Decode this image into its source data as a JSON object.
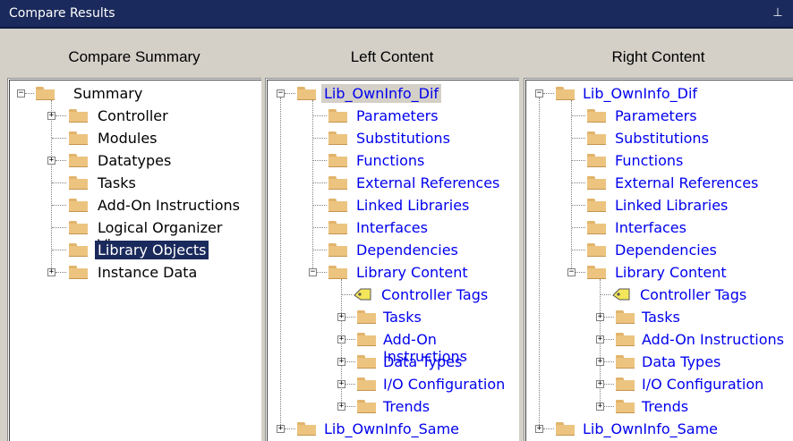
{
  "window": {
    "title": "Compare Results",
    "pin_glyph": "p"
  },
  "columns": {
    "summary_header": "Compare Summary",
    "left_header": "Left Content",
    "right_header": "Right Content"
  },
  "summary_tree": {
    "root": "Summary",
    "items": [
      {
        "label": "Controller",
        "expandable": true
      },
      {
        "label": "Modules",
        "expandable": false
      },
      {
        "label": "Datatypes",
        "expandable": true
      },
      {
        "label": "Tasks",
        "expandable": false
      },
      {
        "label": "Add-On Instructions",
        "expandable": false
      },
      {
        "label": "Logical Organizer View",
        "expandable": false
      },
      {
        "label": "Library Objects",
        "expandable": false,
        "selected": true
      },
      {
        "label": "Instance Data",
        "expandable": true
      }
    ]
  },
  "left_tree": {
    "root": "Lib_OwnInfo_Dif",
    "items": [
      "Parameters",
      "Substitutions",
      "Functions",
      "External References",
      "Linked Libraries",
      "Interfaces",
      "Dependencies"
    ],
    "library_content": "Library Content",
    "controller_tags": "Controller Tags",
    "sub_items": [
      "Tasks",
      "Add-On Instructions",
      "Data Types",
      "I/O Configuration",
      "Trends"
    ],
    "second_root": "Lib_OwnInfo_Same"
  },
  "right_tree": {
    "root": "Lib_OwnInfo_Dif",
    "items": [
      "Parameters",
      "Substitutions",
      "Functions",
      "External References",
      "Linked Libraries",
      "Interfaces",
      "Dependencies"
    ],
    "library_content": "Library Content",
    "controller_tags": "Controller Tags",
    "sub_items": [
      "Tasks",
      "Add-On Instructions",
      "Data Types",
      "I/O Configuration",
      "Trends"
    ],
    "second_root": "Lib_OwnInfo_Same"
  },
  "colors": {
    "title_bar": "#1b2a5c",
    "link": "#0000ee",
    "folder": "#ecc480",
    "tag": "#f3e65a"
  }
}
